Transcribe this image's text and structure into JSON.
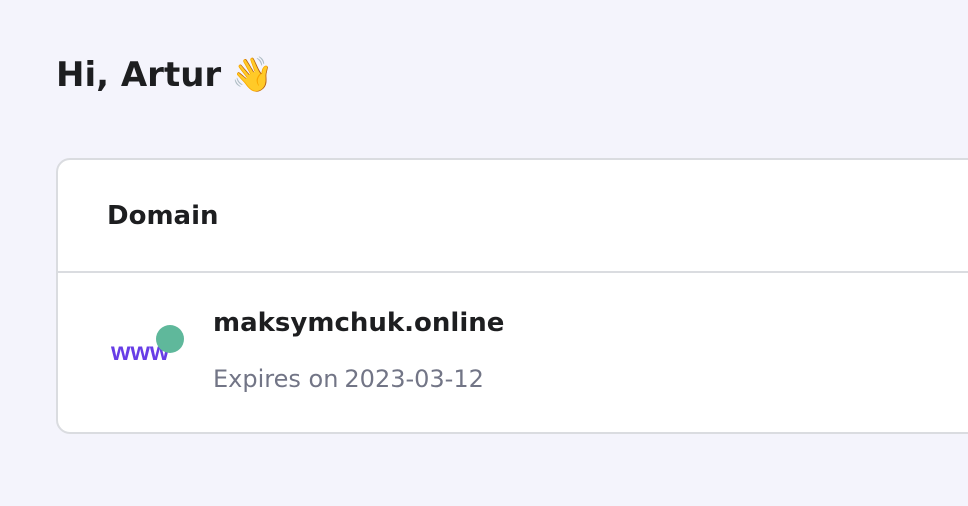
{
  "header": {
    "greeting": "Hi, Artur",
    "greeting_emoji": "👋",
    "emoji_icon": "waving-hand-icon"
  },
  "domains_card": {
    "title": "Domain",
    "items": [
      {
        "icon": "www-icon",
        "icon_text": "www",
        "name": "maksymchuk.online",
        "expires_label": "Expires on",
        "expires_date": "2023-03-12"
      }
    ]
  },
  "colors": {
    "background": "#f4f4fc",
    "card": "#ffffff",
    "border": "#dadce0",
    "text_primary": "#1d1e20",
    "text_secondary": "#727586",
    "icon_purple": "#673de6",
    "icon_green": "#5fb89b"
  }
}
